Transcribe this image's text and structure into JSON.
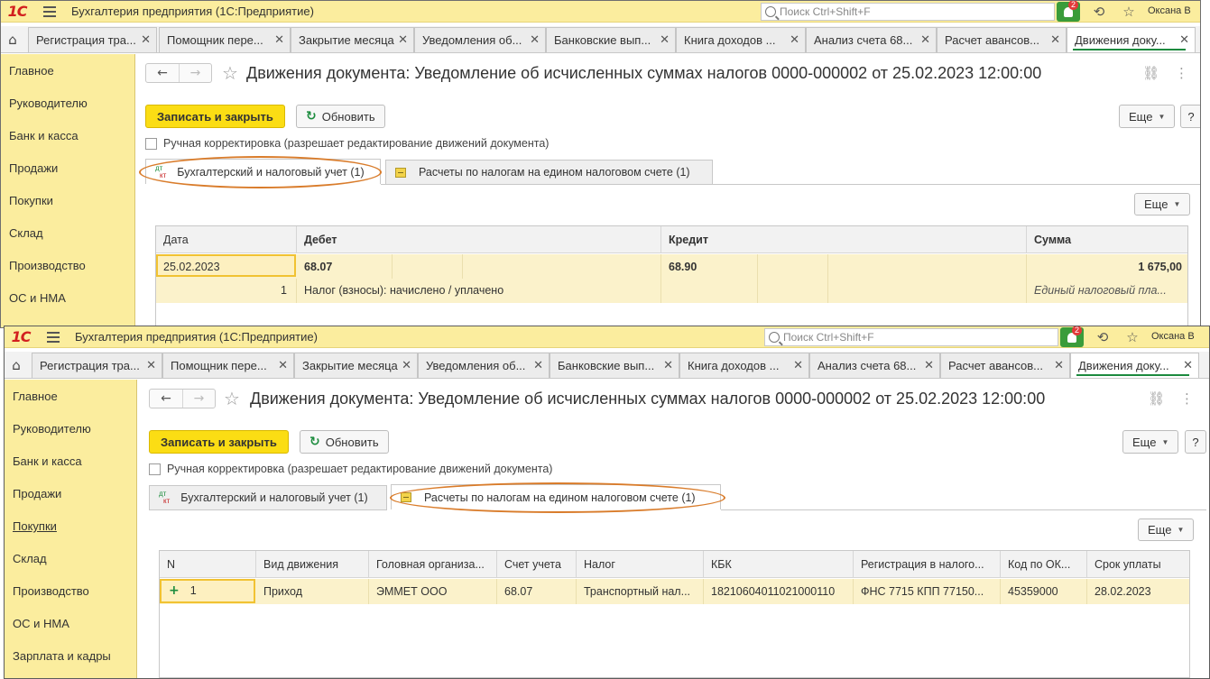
{
  "app": {
    "logo": "1С",
    "title": "Бухгалтерия предприятия  (1С:Предприятие)",
    "search_placeholder": "Поиск Ctrl+Shift+F",
    "notification_count": "2",
    "user": "Оксана В"
  },
  "open_tabs": [
    {
      "label": "Регистрация тра..."
    },
    {
      "label": "Помощник пере..."
    },
    {
      "label": "Закрытие месяца"
    },
    {
      "label": "Уведомления об..."
    },
    {
      "label": "Банковские вып..."
    },
    {
      "label": "Книга доходов ..."
    },
    {
      "label": "Анализ счета 68..."
    },
    {
      "label": "Расчет авансов..."
    },
    {
      "label": "Движения доку..."
    }
  ],
  "sidebar": {
    "items": [
      {
        "label": "Главное"
      },
      {
        "label": "Руководителю"
      },
      {
        "label": "Банк и касса"
      },
      {
        "label": "Продажи"
      },
      {
        "label": "Покупки"
      },
      {
        "label": "Склад"
      },
      {
        "label": "Производство"
      },
      {
        "label": "ОС и НМА"
      },
      {
        "label": "Зарплата и кадры"
      }
    ]
  },
  "document": {
    "title": "Движения документа: Уведомление об исчисленных суммах налогов 0000-000002 от 25.02.2023 12:00:00",
    "save_close_label": "Записать и закрыть",
    "refresh_label": "Обновить",
    "more_label": "Еще",
    "help_label": "?",
    "manual_edit_label": "Ручная корректировка (разрешает редактирование движений документа)",
    "tab_accounting": "Бухгалтерский и налоговый учет (1)",
    "tab_tax_account": "Расчеты по налогам на едином налоговом счете (1)"
  },
  "accounting_table": {
    "headers": [
      "Дата",
      "Дебет",
      "Кредит",
      "Сумма"
    ],
    "row": {
      "date": "25.02.2023",
      "number": "1",
      "debit": "68.07",
      "credit": "68.90",
      "amount": "1 675,00",
      "content": "Налог (взносы): начислено / уплачено",
      "amount_content": "Единый налоговый пла..."
    }
  },
  "tax_table": {
    "headers": [
      "N",
      "Вид движения",
      "Головная организа...",
      "Счет учета",
      "Налог",
      "КБК",
      "Регистрация в налого...",
      "Код по ОК...",
      "Срок уплаты"
    ],
    "row": {
      "number": "1",
      "movement": "Приход",
      "org": "ЭММЕТ ООО",
      "account": "68.07",
      "tax": "Транспортный нал...",
      "kbk": "18210604011021000110",
      "registration": "ФНС 7715 КПП 77150...",
      "okato": "45359000",
      "due": "28.02.2023"
    }
  }
}
